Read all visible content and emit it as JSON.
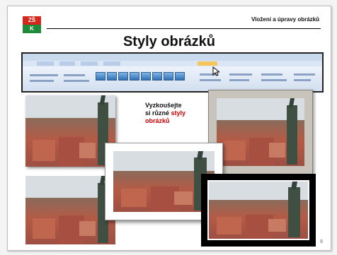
{
  "header": {
    "logo_top": "ZŠ",
    "logo_bottom": "K",
    "section_title": "Vložení a úpravy obrázků",
    "slide_title": "Styly obrázků"
  },
  "slide_text": {
    "line1": "Vyzkoušejte",
    "line2_prefix": "si různé",
    "line2_accent": "styly",
    "line3": "obrázků"
  },
  "page_number": "8"
}
